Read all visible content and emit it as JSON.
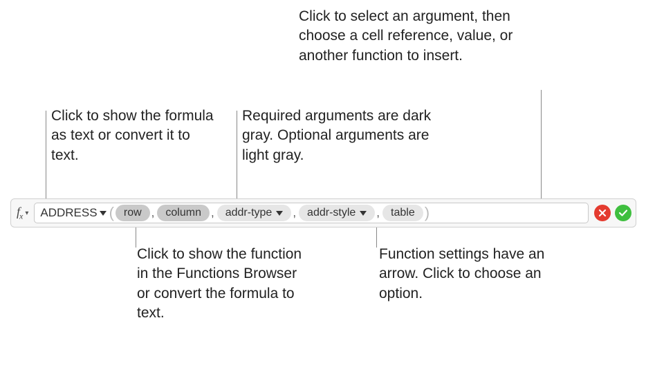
{
  "callouts": {
    "topRight": "Click to select an argument, then choose a cell reference, value, or another function to insert.",
    "topLeft": "Click to show the formula as text or convert it to text.",
    "topMid": "Required arguments are dark gray. Optional arguments are light gray.",
    "bottomLeft": "Click to show the function in the Functions Browser or convert the formula to text.",
    "bottomRight": "Function settings have an arrow. Click to choose an option."
  },
  "formula": {
    "fxLabel": "fx",
    "functionName": "ADDRESS",
    "args": {
      "row": "row",
      "column": "column",
      "addrType": "addr-type",
      "addrStyle": "addr-style",
      "table": "table"
    },
    "separator": ","
  }
}
